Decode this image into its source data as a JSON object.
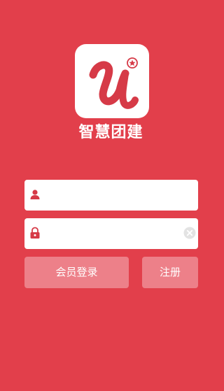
{
  "app": {
    "name": "智慧团建",
    "logo_icon": "league-u-logo-icon"
  },
  "login_form": {
    "username": {
      "icon": "user-icon",
      "value": "",
      "placeholder": ""
    },
    "password": {
      "icon": "lock-icon",
      "value": "",
      "placeholder": "",
      "clear_icon": "clear-icon"
    },
    "login_button": "会员登录",
    "register_button": "注册"
  },
  "colors": {
    "background": "#e23f4b",
    "button_fill": "#ed8089",
    "field_fill": "#ffffff",
    "icon_accent": "#d63a47"
  }
}
